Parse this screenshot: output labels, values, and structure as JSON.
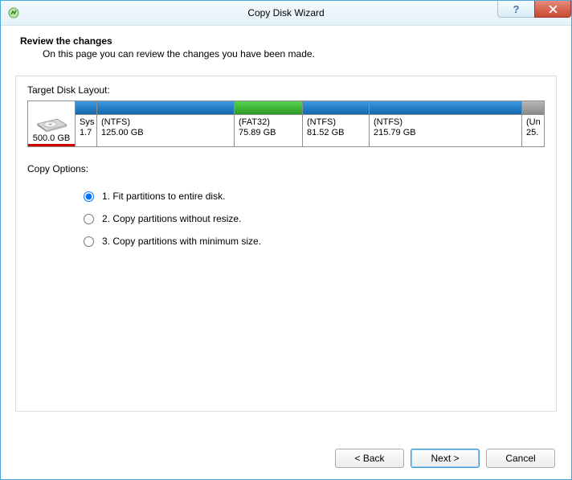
{
  "window": {
    "title": "Copy Disk Wizard",
    "help": "?",
    "close": "x"
  },
  "header": {
    "title": "Review the changes",
    "subtitle": "On this page you can review the changes you have been made."
  },
  "layout": {
    "label": "Target Disk Layout:",
    "disk": {
      "size": "500.0 GB"
    },
    "partitions": {
      "p0": {
        "fs": "Sys",
        "size": "1.7"
      },
      "p1": {
        "fs": "(NTFS)",
        "size": "125.00 GB"
      },
      "p2": {
        "fs": "(FAT32)",
        "size": "75.89 GB"
      },
      "p3": {
        "fs": "(NTFS)",
        "size": "81.52 GB"
      },
      "p4": {
        "fs": "(NTFS)",
        "size": "215.79 GB"
      },
      "p5": {
        "fs": "(Un",
        "size": "25."
      }
    }
  },
  "options": {
    "label": "Copy Options:",
    "o1": "1. Fit partitions to entire disk.",
    "o2": "2. Copy partitions without resize.",
    "o3": "3. Copy partitions with minimum size.",
    "selected": "o1"
  },
  "footer": {
    "back": "< Back",
    "next": "Next >",
    "cancel": "Cancel"
  }
}
